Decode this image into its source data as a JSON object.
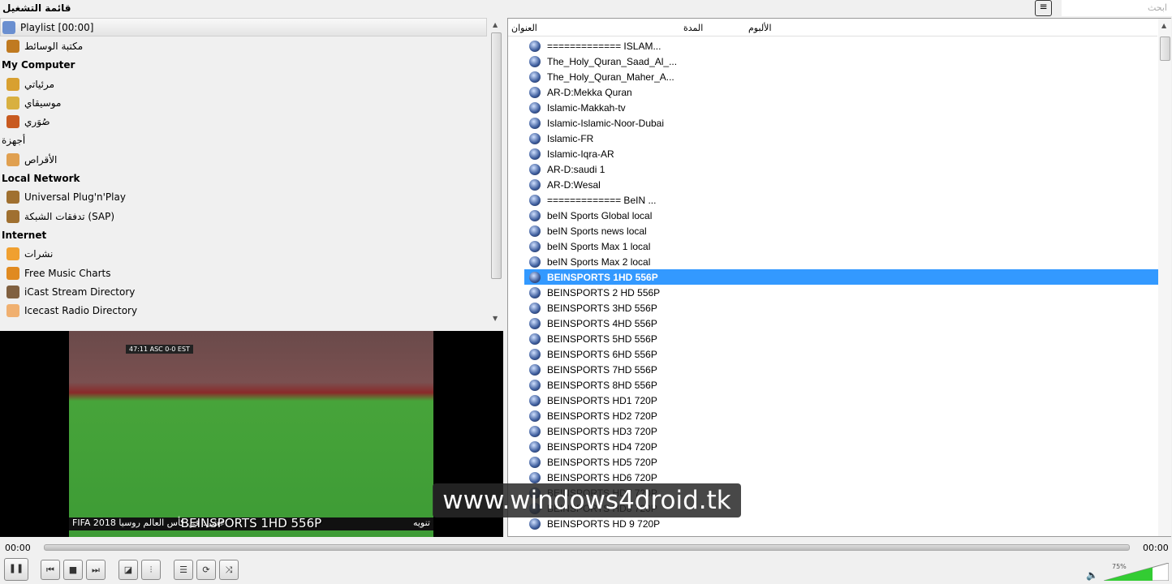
{
  "sidebar": {
    "title": "قائمة التشغيل",
    "items": [
      {
        "label": "Playlist [00:00]",
        "type": "item",
        "selected": true,
        "icon": "playlist-icon"
      },
      {
        "label": "مكتبة الوسائط",
        "type": "item",
        "icon": "library-icon"
      },
      {
        "label": "My Computer",
        "type": "header"
      },
      {
        "label": "مرئياتي",
        "type": "item",
        "icon": "video-icon"
      },
      {
        "label": "موسيقاي",
        "type": "item",
        "icon": "music-icon"
      },
      {
        "label": "صُوَري",
        "type": "item",
        "icon": "pictures-icon"
      },
      {
        "label": "أجهزة",
        "type": "header-plain"
      },
      {
        "label": "الأقراص",
        "type": "item",
        "icon": "disc-icon"
      },
      {
        "label": "Local Network",
        "type": "header"
      },
      {
        "label": "Universal Plug'n'Play",
        "type": "item",
        "icon": "network-icon"
      },
      {
        "label": "تدفقات الشبكة (SAP)",
        "type": "item",
        "icon": "network-icon"
      },
      {
        "label": "Internet",
        "type": "header"
      },
      {
        "label": "نشرات",
        "type": "item",
        "icon": "podcast-icon"
      },
      {
        "label": "Free Music Charts",
        "type": "item",
        "icon": "music-charts-icon"
      },
      {
        "label": "iCast Stream Directory",
        "type": "item",
        "icon": "icast-icon"
      },
      {
        "label": "Icecast Radio Directory",
        "type": "item",
        "icon": "icecast-icon"
      }
    ]
  },
  "video": {
    "subtitle": "BEINSPORTS 1HD 556P",
    "score": "47:11  ASC 0-0 EST",
    "ticker_left": "FIFA 2018 عشرة في كأس العالم روسيا",
    "ticker_right": "تنويه"
  },
  "watermark": "www.windows4droid.tk",
  "search": {
    "placeholder": "ابحث"
  },
  "columns": {
    "title": "العنوان",
    "duration": "المدة",
    "album": "الألبوم"
  },
  "playlist": [
    "============= ISLAM...",
    "The_Holy_Quran_Saad_Al_...",
    "The_Holy_Quran_Maher_A...",
    "AR-D:Mekka Quran",
    "Islamic-Makkah-tv",
    "Islamic-Islamic-Noor-Dubai",
    "Islamic-FR",
    "Islamic-Iqra-AR",
    "AR-D:saudi 1",
    "AR-D:Wesal",
    "============= BeIN ...",
    "beIN Sports Global local",
    "beIN Sports news local",
    "beIN Sports Max 1 local",
    "beIN Sports Max 2 local",
    "BEINSPORTS 1HD 556P",
    "BEINSPORTS 2 HD 556P",
    "BEINSPORTS 3HD 556P",
    "BEINSPORTS 4HD 556P",
    "BEINSPORTS 5HD 556P",
    "BEINSPORTS 6HD 556P",
    "BEINSPORTS 7HD 556P",
    "BEINSPORTS 8HD 556P",
    "BEINSPORTS HD1 720P",
    "BEINSPORTS HD2 720P",
    "BEINSPORTS HD3 720P",
    "BEINSPORTS HD4 720P",
    "BEINSPORTS HD5 720P",
    "BEINSPORTS HD6 720P",
    "BEINSPORTS HD7 720P",
    "BEINSPORTS HD8 720P",
    "BEINSPORTS HD 9 720P"
  ],
  "selected_index": 15,
  "controls": {
    "elapsed": "00:00",
    "total": "00:00",
    "volume": "75%",
    "volume_value": 75,
    "seek_progress": 0
  },
  "colors": {
    "selection": "#3399ff",
    "volume_fill": "#33cc33"
  }
}
